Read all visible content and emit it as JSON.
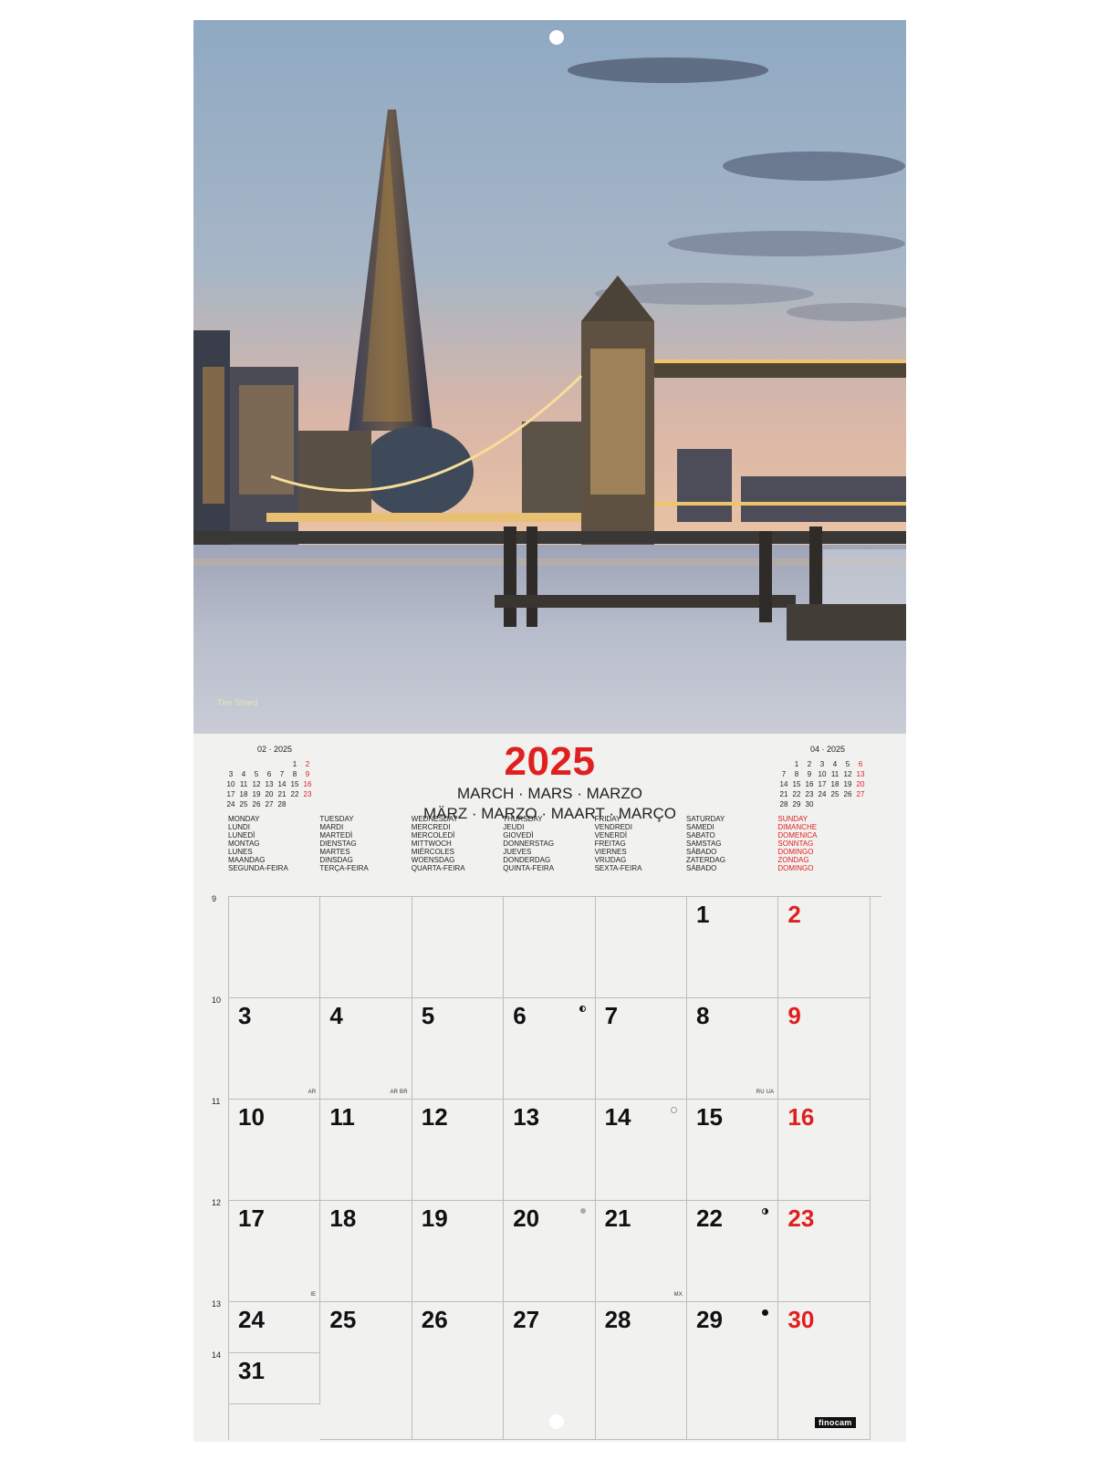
{
  "photo": {
    "caption": "The Shard"
  },
  "header": {
    "year": "2025",
    "months_line1": "MARCH · MARS · MARZO",
    "months_line2": "MÄRZ · MARZO · MAART · MARÇO"
  },
  "mini_prev": {
    "title": "02 · 2025",
    "cells": [
      "",
      "",
      "",
      "",
      "",
      "1",
      "2",
      "3",
      "4",
      "5",
      "6",
      "7",
      "8",
      "9",
      "10",
      "11",
      "12",
      "13",
      "14",
      "15",
      "16",
      "17",
      "18",
      "19",
      "20",
      "21",
      "22",
      "23",
      "24",
      "25",
      "26",
      "27",
      "28",
      "",
      ""
    ]
  },
  "mini_next": {
    "title": "04 · 2025",
    "cells": [
      "",
      "1",
      "2",
      "3",
      "4",
      "5",
      "6",
      "7",
      "8",
      "9",
      "10",
      "11",
      "12",
      "13",
      "14",
      "15",
      "16",
      "17",
      "18",
      "19",
      "20",
      "21",
      "22",
      "23",
      "24",
      "25",
      "26",
      "27",
      "28",
      "29",
      "30",
      "",
      "",
      "",
      ""
    ]
  },
  "day_headers": [
    [
      "MONDAY",
      "LUNDI",
      "LUNEDÌ",
      "MONTAG",
      "LUNES",
      "MAANDAG",
      "SEGUNDA-FEIRA"
    ],
    [
      "TUESDAY",
      "MARDI",
      "MARTEDÌ",
      "DIENSTAG",
      "MARTES",
      "DINSDAG",
      "TERÇA-FEIRA"
    ],
    [
      "WEDNESDAY",
      "MERCREDI",
      "MERCOLEDÌ",
      "MITTWOCH",
      "MIÉRCOLES",
      "WOENSDAG",
      "QUARTA-FEIRA"
    ],
    [
      "THURSDAY",
      "JEUDI",
      "GIOVEDÌ",
      "DONNERSTAG",
      "JUEVES",
      "DONDERDAG",
      "QUINTA-FEIRA"
    ],
    [
      "FRIDAY",
      "VENDREDI",
      "VENERDÌ",
      "FREITAG",
      "VIERNES",
      "VRIJDAG",
      "SEXTA-FEIRA"
    ],
    [
      "SATURDAY",
      "SAMEDI",
      "SABATO",
      "SAMSTAG",
      "SÁBADO",
      "ZATERDAG",
      "SÁBADO"
    ],
    [
      "SUNDAY",
      "DIMANCHE",
      "DOMENICA",
      "SONNTAG",
      "DOMINGO",
      "ZONDAG",
      "DOMINGO"
    ]
  ],
  "weeks": [
    {
      "num": "9",
      "days": [
        "",
        "",
        "",
        "",
        "",
        "1",
        "2"
      ]
    },
    {
      "num": "10",
      "days": [
        "3",
        "4",
        "5",
        "6",
        "7",
        "8",
        "9"
      ]
    },
    {
      "num": "11",
      "days": [
        "10",
        "11",
        "12",
        "13",
        "14",
        "15",
        "16"
      ]
    },
    {
      "num": "12",
      "days": [
        "17",
        "18",
        "19",
        "20",
        "21",
        "22",
        "23"
      ]
    },
    {
      "num": "13",
      "days": [
        "24",
        "25",
        "26",
        "27",
        "28",
        "29",
        "30"
      ]
    },
    {
      "num": "14",
      "days": [
        "31",
        "",
        "",
        "",
        "",
        "",
        ""
      ]
    }
  ],
  "holiday_tags": {
    "3": "AR",
    "4": "AR BR",
    "8": "RU UA",
    "17": "IE",
    "21": "MX"
  },
  "moon_phases": {
    "6": "first-quarter",
    "14": "full-moon",
    "20": "equinox",
    "22": "last-quarter",
    "29": "new-moon"
  },
  "brand": "finocam",
  "colors": {
    "sunday": "#e01f1f",
    "year": "#e01f1f",
    "grid": "#bdbdbd",
    "paper": "#f1f1ef"
  }
}
